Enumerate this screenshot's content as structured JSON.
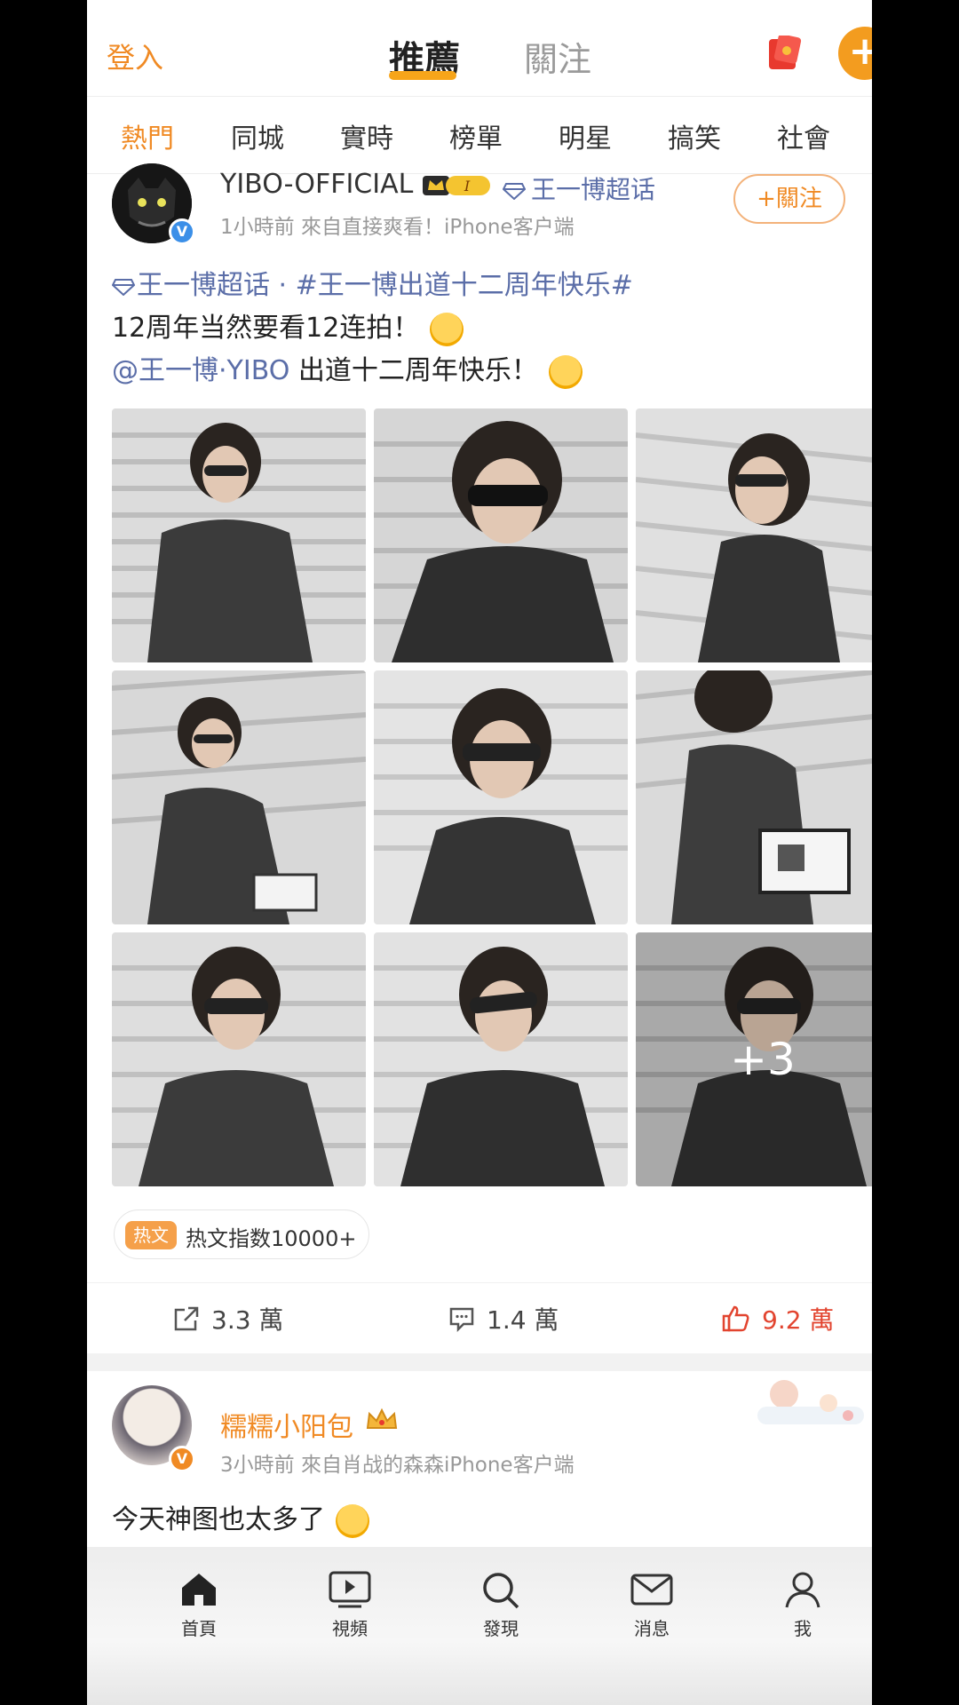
{
  "topbar": {
    "login_label": "登入",
    "tabs": [
      {
        "label": "推薦",
        "active": true
      },
      {
        "label": "關注",
        "active": false
      }
    ],
    "plus_label": "+"
  },
  "categories": [
    {
      "label": "熱門",
      "active": true
    },
    {
      "label": "同城"
    },
    {
      "label": "實時"
    },
    {
      "label": "榜單"
    },
    {
      "label": "明星"
    },
    {
      "label": "搞笑"
    },
    {
      "label": "社會"
    }
  ],
  "post1": {
    "username": "YIBO-OFFICIAL",
    "level_badge": "I",
    "supertopic": "王一博超话",
    "meta": "1小時前  來自直接爽看！iPhone客户端",
    "follow_label": "+關注",
    "line1_topic": "王一博超话",
    "line1_sep": " · ",
    "line1_hashtag": "#王一博出道十二周年快乐#",
    "line2": "12周年当然要看12连拍！",
    "line3_mention": "@王一博·YIBO",
    "line3_rest": " 出道十二周年快乐！",
    "more_count": "+3",
    "hot_tag": "热文",
    "hot_text": "热文指数10000+",
    "actions": {
      "repost": "3.3 萬",
      "comment": "1.4 萬",
      "like": "9.2 萬"
    }
  },
  "post2": {
    "username": "糯糯小阳包",
    "meta": "3小時前  來自肖战的森森iPhone客户端",
    "text": "今天神图也太多了"
  },
  "bottomnav": [
    {
      "label": "首頁",
      "icon": "home-icon"
    },
    {
      "label": "視頻",
      "icon": "video-icon"
    },
    {
      "label": "發現",
      "icon": "search-icon"
    },
    {
      "label": "消息",
      "icon": "mail-icon"
    },
    {
      "label": "我",
      "icon": "profile-icon"
    }
  ],
  "colors": {
    "accent": "#f08a24",
    "link": "#5b6ea8",
    "like": "#e2442f"
  }
}
